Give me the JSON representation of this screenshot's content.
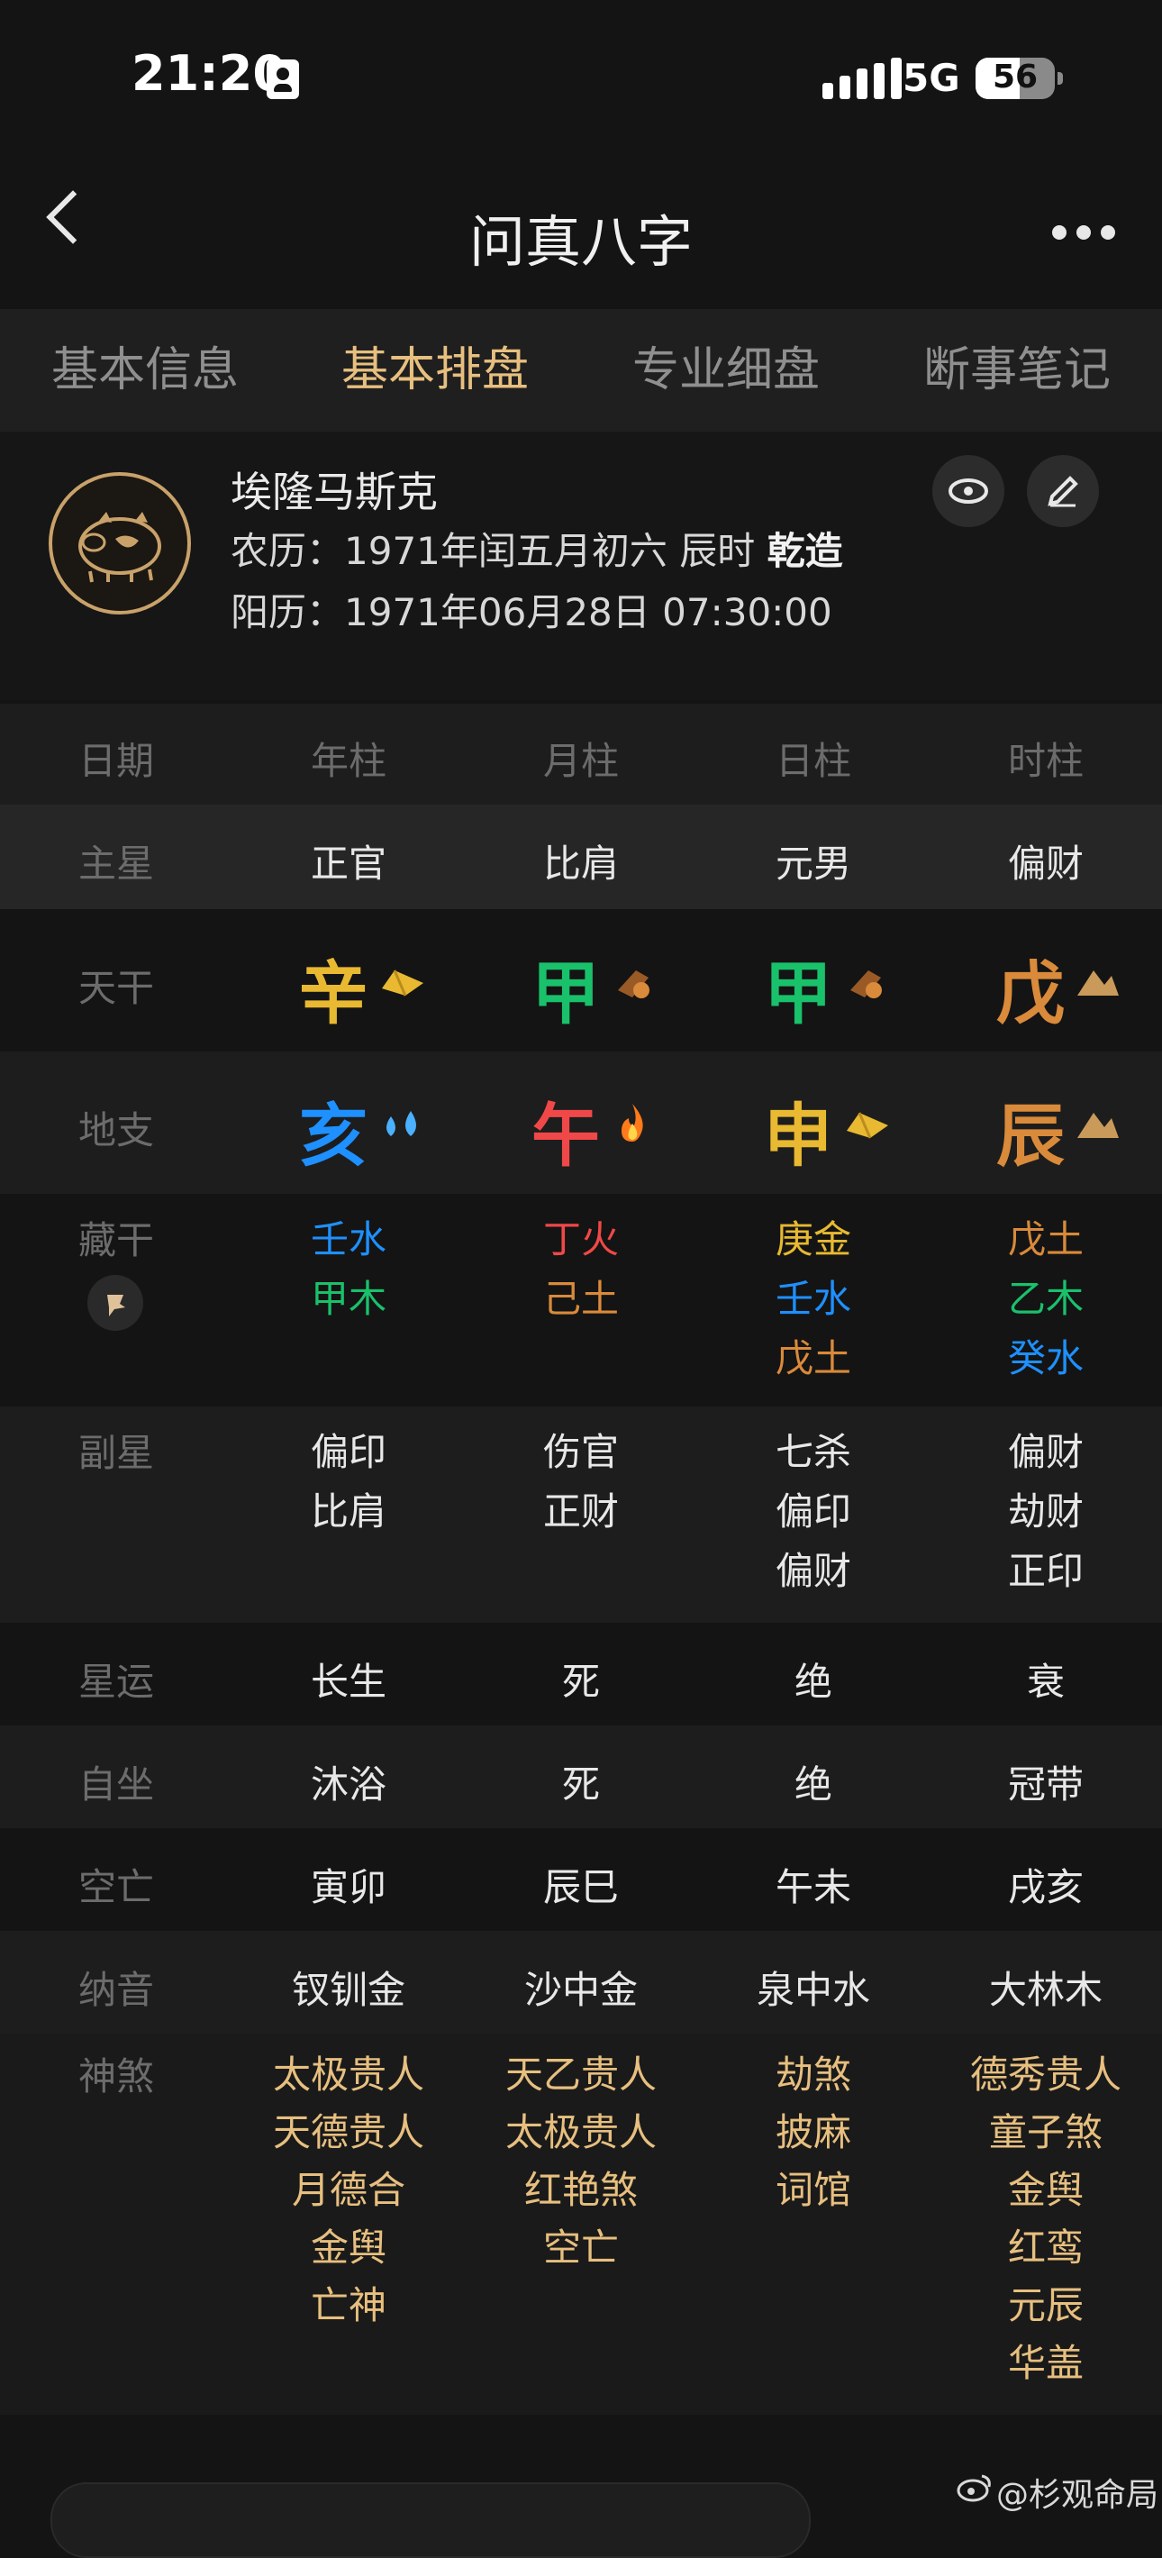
{
  "status": {
    "time": "21:20",
    "network": "5G",
    "battery": "56"
  },
  "nav": {
    "title": "问真八字"
  },
  "tabs": [
    "基本信息",
    "基本排盘",
    "专业细盘",
    "断事笔记"
  ],
  "profile": {
    "name": "埃隆马斯克",
    "lunar_prefix": "农历：1971年闰五月初六 辰时 ",
    "lunar_gender": "乾造",
    "solar": "阳历：1971年06月28日 07:30:00"
  },
  "table": {
    "header": [
      "日期",
      "年柱",
      "月柱",
      "日柱",
      "时柱"
    ],
    "labels": {
      "zhuxing": "主星",
      "tiangan": "天干",
      "dizhi": "地支",
      "canggan": "藏干",
      "fuxing": "副星",
      "xingyun": "星运",
      "zizuo": "自坐",
      "kongwang": "空亡",
      "nayin": "纳音",
      "shensha": "神煞"
    },
    "zhuxing": [
      "正官",
      "比肩",
      "元男",
      "偏财"
    ],
    "tiangan": [
      "辛",
      "甲",
      "甲",
      "戊"
    ],
    "dizhi": [
      "亥",
      "午",
      "申",
      "辰"
    ],
    "canggan": [
      [
        "壬水",
        "甲木"
      ],
      [
        "丁火",
        "己土"
      ],
      [
        "庚金",
        "壬水",
        "戊土"
      ],
      [
        "戊土",
        "乙木",
        "癸水"
      ]
    ],
    "fuxing": [
      [
        "偏印",
        "比肩"
      ],
      [
        "伤官",
        "正财"
      ],
      [
        "七杀",
        "偏印",
        "偏财"
      ],
      [
        "偏财",
        "劫财",
        "正印"
      ]
    ],
    "xingyun": [
      "长生",
      "死",
      "绝",
      "衰"
    ],
    "zizuo": [
      "沐浴",
      "死",
      "绝",
      "冠带"
    ],
    "kongwang": [
      "寅卯",
      "辰巳",
      "午未",
      "戌亥"
    ],
    "nayin": [
      "钗钏金",
      "沙中金",
      "泉中水",
      "大林木"
    ],
    "shensha": [
      [
        "太极贵人",
        "天德贵人",
        "月德合",
        "金舆",
        "亡神"
      ],
      [
        "天乙贵人",
        "太极贵人",
        "红艳煞",
        "空亡"
      ],
      [
        "劫煞",
        "披麻",
        "词馆"
      ],
      [
        "德秀贵人",
        "童子煞",
        "金舆",
        "红鸾",
        "元辰",
        "华盖"
      ]
    ]
  },
  "colors": {
    "metal": "#e8b931",
    "wood": "#19c16b",
    "water": "#1e90ff",
    "fire": "#f04848",
    "earth": "#d98a3a",
    "accent": "#e7bf7f"
  },
  "watermark": "@杉观命局"
}
